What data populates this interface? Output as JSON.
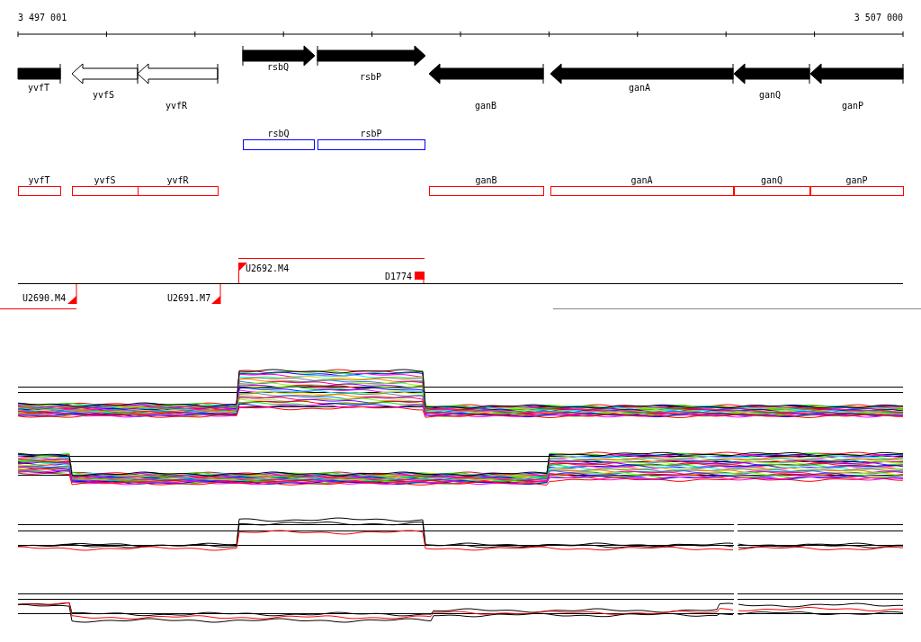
{
  "ruler": {
    "start_label": "3 497 001",
    "end_label": "3 507 000"
  },
  "genes": [
    {
      "name": "yvfT",
      "kind": "partial",
      "filled": true
    },
    {
      "name": "yvfS",
      "kind": "reverse",
      "filled": false
    },
    {
      "name": "yvfR",
      "kind": "reverse",
      "filled": false
    },
    {
      "name": "rsbQ",
      "kind": "forward",
      "filled": true
    },
    {
      "name": "rsbP",
      "kind": "forward",
      "filled": true
    },
    {
      "name": "ganB",
      "kind": "reverse",
      "filled": true
    },
    {
      "name": "ganA",
      "kind": "reverse",
      "filled": true
    },
    {
      "name": "ganQ",
      "kind": "reverse",
      "filled": true
    },
    {
      "name": "ganP",
      "kind": "reverse",
      "filled": true
    }
  ],
  "blue_track": [
    {
      "name": "rsbQ"
    },
    {
      "name": "rsbP"
    }
  ],
  "red_track": [
    {
      "name": "yvfT"
    },
    {
      "name": "yvfS"
    },
    {
      "name": "yvfR"
    },
    {
      "name": "ganB"
    },
    {
      "name": "ganA"
    },
    {
      "name": "ganQ"
    },
    {
      "name": "ganP"
    }
  ],
  "transcription_marks": [
    {
      "label": "U2690.M4",
      "kind": "promoter-below"
    },
    {
      "label": "U2691.M7",
      "kind": "promoter-below"
    },
    {
      "label": "U2692.M4",
      "kind": "promoter-above"
    },
    {
      "label": "D1774",
      "kind": "terminator"
    }
  ]
}
